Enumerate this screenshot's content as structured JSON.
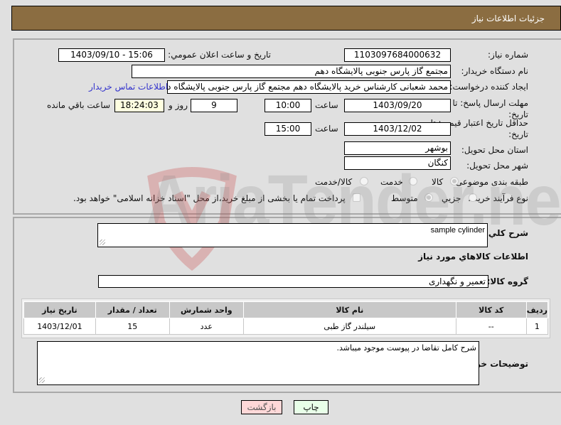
{
  "header": {
    "title": "جزئیات اطلاعات نیاز"
  },
  "form": {
    "need_number": {
      "label": "شماره نیاز:",
      "value": "1103097684000632"
    },
    "announce_datetime": {
      "label": "تاریخ و ساعت اعلان عمومي:",
      "value": "1403/09/10 - 15:06"
    },
    "buyer_org": {
      "label": "نام دستگاه خريدار:",
      "value": "مجتمع گاز پارس جنوبی  پالایشگاه دهم"
    },
    "requester": {
      "label": "ایجاد کننده درخواست:",
      "value": "محمد شعبانی کارشناس خرید پالایشگاه دهم  مجتمع گاز پارس جنوبی  پالایشگاه دهم",
      "contact_link": "اطلاعات تماس خریدار"
    },
    "reply_deadline": {
      "label": "مهلت ارسال پاسخ: تا تاریخ:",
      "date": "1403/09/20",
      "time_label": "ساعت",
      "time": "10:00",
      "days": "9",
      "days_label": "روز و",
      "remaining": "18:24:03",
      "remaining_label": "ساعت باقي مانده"
    },
    "price_validity": {
      "label": "حداقل تاریخ اعتبار قیمت: تا تاریخ:",
      "date": "1403/12/02",
      "time_label": "ساعت",
      "time": "15:00"
    },
    "province": {
      "label": "استان محل تحویل:",
      "value": "بوشهر"
    },
    "city": {
      "label": "شهر محل تحویل:",
      "value": "کنگان"
    },
    "category": {
      "label": "طبقه بندی موضوعی:",
      "options": [
        "کالا",
        "خدمت",
        "کالا/خدمت"
      ],
      "selected": "کالا"
    },
    "purchase_type": {
      "label": "نوع فرآیند خرید :",
      "options": [
        "جزیي",
        "متوسط"
      ],
      "selected": "متوسط",
      "treasury_checkbox_label": "پرداخت تمام یا بخشی از مبلغ خرید،از محل \"اسناد خزانه اسلامی\" خواهد بود.",
      "treasury_checked": false
    }
  },
  "details": {
    "description_label": "شرح کلي نیاز:",
    "description_value": "sample cylinder",
    "goods_section_title": "اطلاعات کالاهاي مورد نیاز",
    "goods_group_label": "گروه کالا:",
    "goods_group_value": "تعمیر و نگهداری",
    "table": {
      "headers": [
        "ردیف",
        "کد کالا",
        "نام کالا",
        "واحد شمارش",
        "تعداد / مقدار",
        "تاریخ نیاز"
      ],
      "rows": [
        [
          "1",
          "--",
          "سیلندر گاز طبی",
          "عدد",
          "15",
          "1403/12/01"
        ]
      ]
    },
    "buyer_notes_label": "توضیحات خریدار:",
    "buyer_notes_value": "شرح کامل تقاضا در پیوست موجود میباشد."
  },
  "buttons": {
    "print": "چاپ",
    "back": "بازگشت"
  },
  "watermark": {
    "text": "AriaTender.neT"
  }
}
